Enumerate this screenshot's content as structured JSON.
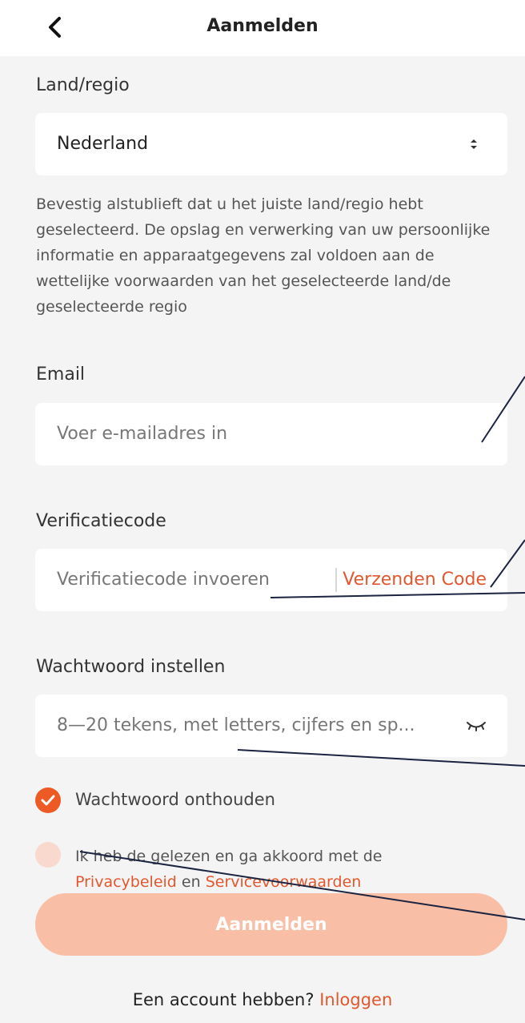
{
  "header": {
    "title": "Aanmelden",
    "back_icon": "chevron-left-icon"
  },
  "region": {
    "label": "Land/regio",
    "value": "Nederland",
    "note": "Bevestig alstublieft dat u het juiste land/regio hebt geselecteerd. De opslag en verwerking van uw persoonlijke informatie en apparaatgegevens zal voldoen aan de wettelijke voorwaarden van het geselecteerde land/de geselecteerde regio"
  },
  "email": {
    "label": "Email",
    "placeholder": "Voer e-mailadres in"
  },
  "verification": {
    "label": "Verificatiecode",
    "placeholder": "Verificatiecode invoeren",
    "send_label": "Verzenden Code"
  },
  "password": {
    "label": "Wachtwoord instellen",
    "placeholder": "8—20 tekens, met letters, cijfers en sp...",
    "eye_icon": "eye-closed-icon"
  },
  "remember": {
    "label": "Wachtwoord onthouden",
    "checked": true
  },
  "agreement": {
    "checked": false,
    "text_before": "Ik heb de gelezen en ga akkoord met de",
    "privacy_link": "Privacybeleid",
    "conjunction": "en",
    "service_link": "Servicevoorwaarden"
  },
  "submit": {
    "label": "Aanmelden"
  },
  "footer": {
    "text": "Een account hebben?",
    "login_link": "Inloggen"
  },
  "colors": {
    "accent": "#e4572e",
    "button_disabled": "#f9bea6",
    "background": "#f4f4f4"
  }
}
